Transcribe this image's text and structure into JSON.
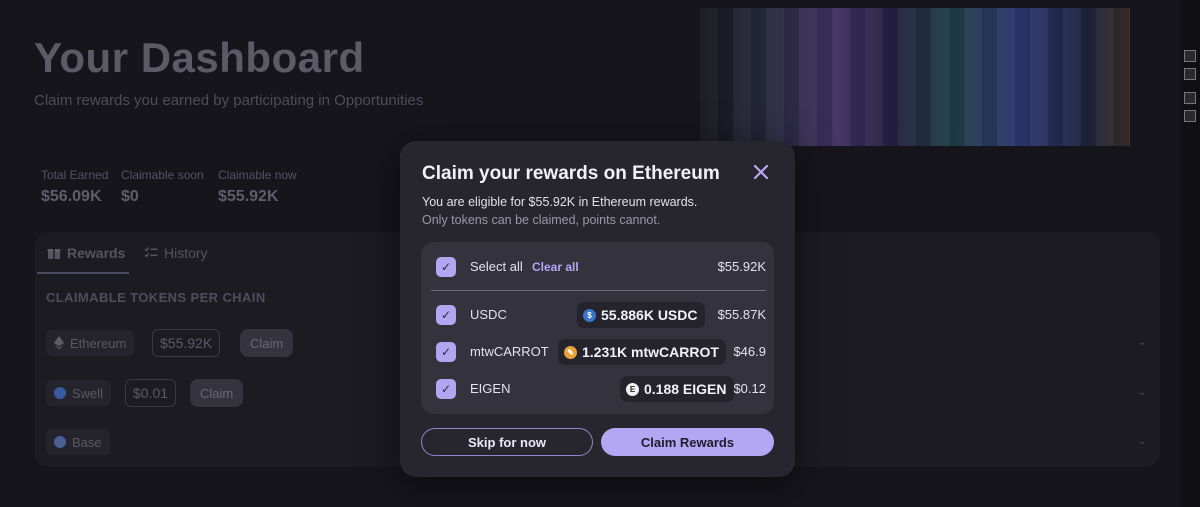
{
  "header": {
    "title": "Your Dashboard",
    "subtitle": "Claim rewards you earned by participating in Opportunities"
  },
  "stats": [
    {
      "label": "Total Earned",
      "value": "$56.09K"
    },
    {
      "label": "Claimable soon",
      "value": "$0"
    },
    {
      "label": "Claimable now",
      "value": "$55.92K"
    }
  ],
  "tabs": [
    {
      "label": "Rewards",
      "icon": "gift-icon",
      "active": true
    },
    {
      "label": "History",
      "icon": "list-check-icon",
      "active": false
    }
  ],
  "section_title": "CLAIMABLE TOKENS PER CHAIN",
  "chains": [
    {
      "name": "Ethereum",
      "value": "$55.92K",
      "claim_label": "Claim",
      "icon": "ethereum-icon"
    },
    {
      "name": "Swell",
      "value": "$0.01",
      "claim_label": "Claim",
      "icon": "swell-icon"
    },
    {
      "name": "Base",
      "icon": "base-icon"
    }
  ],
  "modal": {
    "title": "Claim your rewards on Ethereum",
    "line1": "You are eligible for $55.92K in Ethereum rewards.",
    "line2": "Only tokens can be claimed, points cannot.",
    "select_all_label": "Select all",
    "clear_all_label": "Clear all",
    "select_all_total": "$55.92K",
    "tokens": [
      {
        "symbol": "USDC",
        "amount": "55.886K USDC",
        "usd": "$55.87K",
        "icon": "usdc-icon",
        "icon_color": "#3b74c8"
      },
      {
        "symbol": "mtwCARROT",
        "amount": "1.231K mtwCARROT",
        "usd": "$46.9",
        "icon": "carrot-icon",
        "icon_color": "#e8a23a"
      },
      {
        "symbol": "EIGEN",
        "amount": "0.188 EIGEN",
        "usd": "$0.12",
        "icon": "eigen-icon",
        "icon_color": "#f1f1f1"
      }
    ],
    "skip_label": "Skip for now",
    "claim_label": "Claim Rewards"
  }
}
